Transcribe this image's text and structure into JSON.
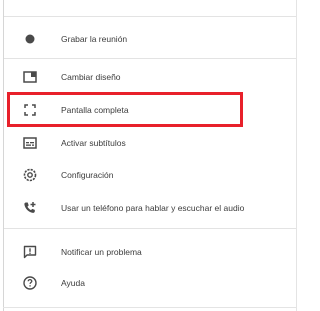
{
  "menu": {
    "items": [
      {
        "icon": "record-icon",
        "label": "Grabar la reunión"
      },
      {
        "icon": "layout-icon",
        "label": "Cambiar diseño"
      },
      {
        "icon": "fullscreen-icon",
        "label": "Pantalla completa"
      },
      {
        "icon": "captions-icon",
        "label": "Activar subtítulos"
      },
      {
        "icon": "settings-icon",
        "label": "Configuración"
      },
      {
        "icon": "phone-audio-icon",
        "label": "Usar un teléfono para hablar y escuchar el audio"
      },
      {
        "icon": "report-problem-icon",
        "label": "Notificar un problema"
      },
      {
        "icon": "help-icon",
        "label": "Ayuda"
      }
    ]
  },
  "colors": {
    "highlight": "#e8202a",
    "icon": "#4a4a4a",
    "text": "#3c3c3c"
  }
}
